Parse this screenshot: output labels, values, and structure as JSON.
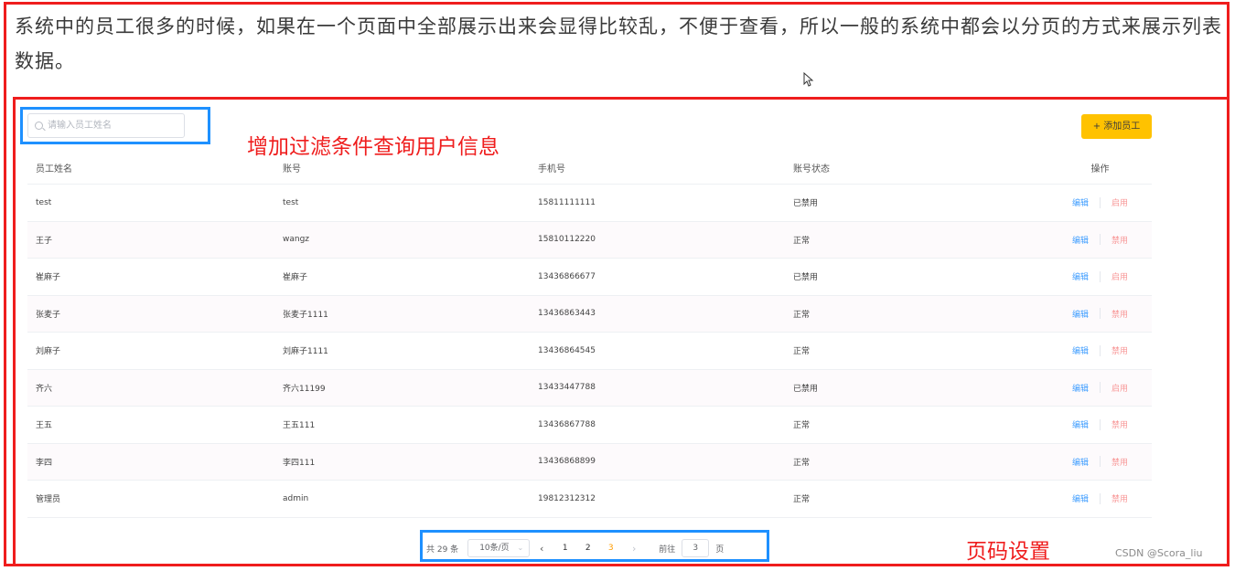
{
  "intro_text": "系统中的员工很多的时候，如果在一个页面中全部展示出来会显得比较乱，不便于查看，所以一般的系统中都会以分页的方式来展示列表数据。",
  "annotations": {
    "filter_note": "增加过滤条件查询用户信息",
    "pager_note": "页码设置",
    "box_color_red": "#ef1d1d",
    "box_color_blue": "#1e90ff"
  },
  "search": {
    "placeholder": "请输入员工姓名",
    "value": ""
  },
  "toolbar": {
    "add_label": "+ 添加员工",
    "add_color": "#ffc200"
  },
  "table": {
    "headers": [
      "员工姓名",
      "账号",
      "手机号",
      "账号状态",
      "操作"
    ],
    "rows": [
      {
        "name": "test",
        "account": "test",
        "phone": "15811111111",
        "status": "已禁用",
        "edit": "编辑",
        "toggle": "启用"
      },
      {
        "name": "王子",
        "account": "wangz",
        "phone": "15810112220",
        "status": "正常",
        "edit": "编辑",
        "toggle": "禁用"
      },
      {
        "name": "崔麻子",
        "account": "崔麻子",
        "phone": "13436866677",
        "status": "已禁用",
        "edit": "编辑",
        "toggle": "启用"
      },
      {
        "name": "张麦子",
        "account": "张麦子1111",
        "phone": "13436863443",
        "status": "正常",
        "edit": "编辑",
        "toggle": "禁用"
      },
      {
        "name": "刘麻子",
        "account": "刘麻子1111",
        "phone": "13436864545",
        "status": "正常",
        "edit": "编辑",
        "toggle": "禁用"
      },
      {
        "name": "齐六",
        "account": "齐六11199",
        "phone": "13433447788",
        "status": "已禁用",
        "edit": "编辑",
        "toggle": "启用"
      },
      {
        "name": "王五",
        "account": "王五111",
        "phone": "13436867788",
        "status": "正常",
        "edit": "编辑",
        "toggle": "禁用"
      },
      {
        "name": "李四",
        "account": "李四111",
        "phone": "13436868899",
        "status": "正常",
        "edit": "编辑",
        "toggle": "禁用"
      },
      {
        "name": "管理员",
        "account": "admin",
        "phone": "19812312312",
        "status": "正常",
        "edit": "编辑",
        "toggle": "禁用"
      }
    ]
  },
  "pagination": {
    "total_label": "共 29 条",
    "page_size": "10条/页",
    "prev": "‹",
    "next": "›",
    "pages": [
      "1",
      "2",
      "3"
    ],
    "current_page": "3",
    "goto_label": "前往",
    "goto_value": "3",
    "goto_suffix": "页"
  },
  "watermark": "CSDN @Scora_liu"
}
